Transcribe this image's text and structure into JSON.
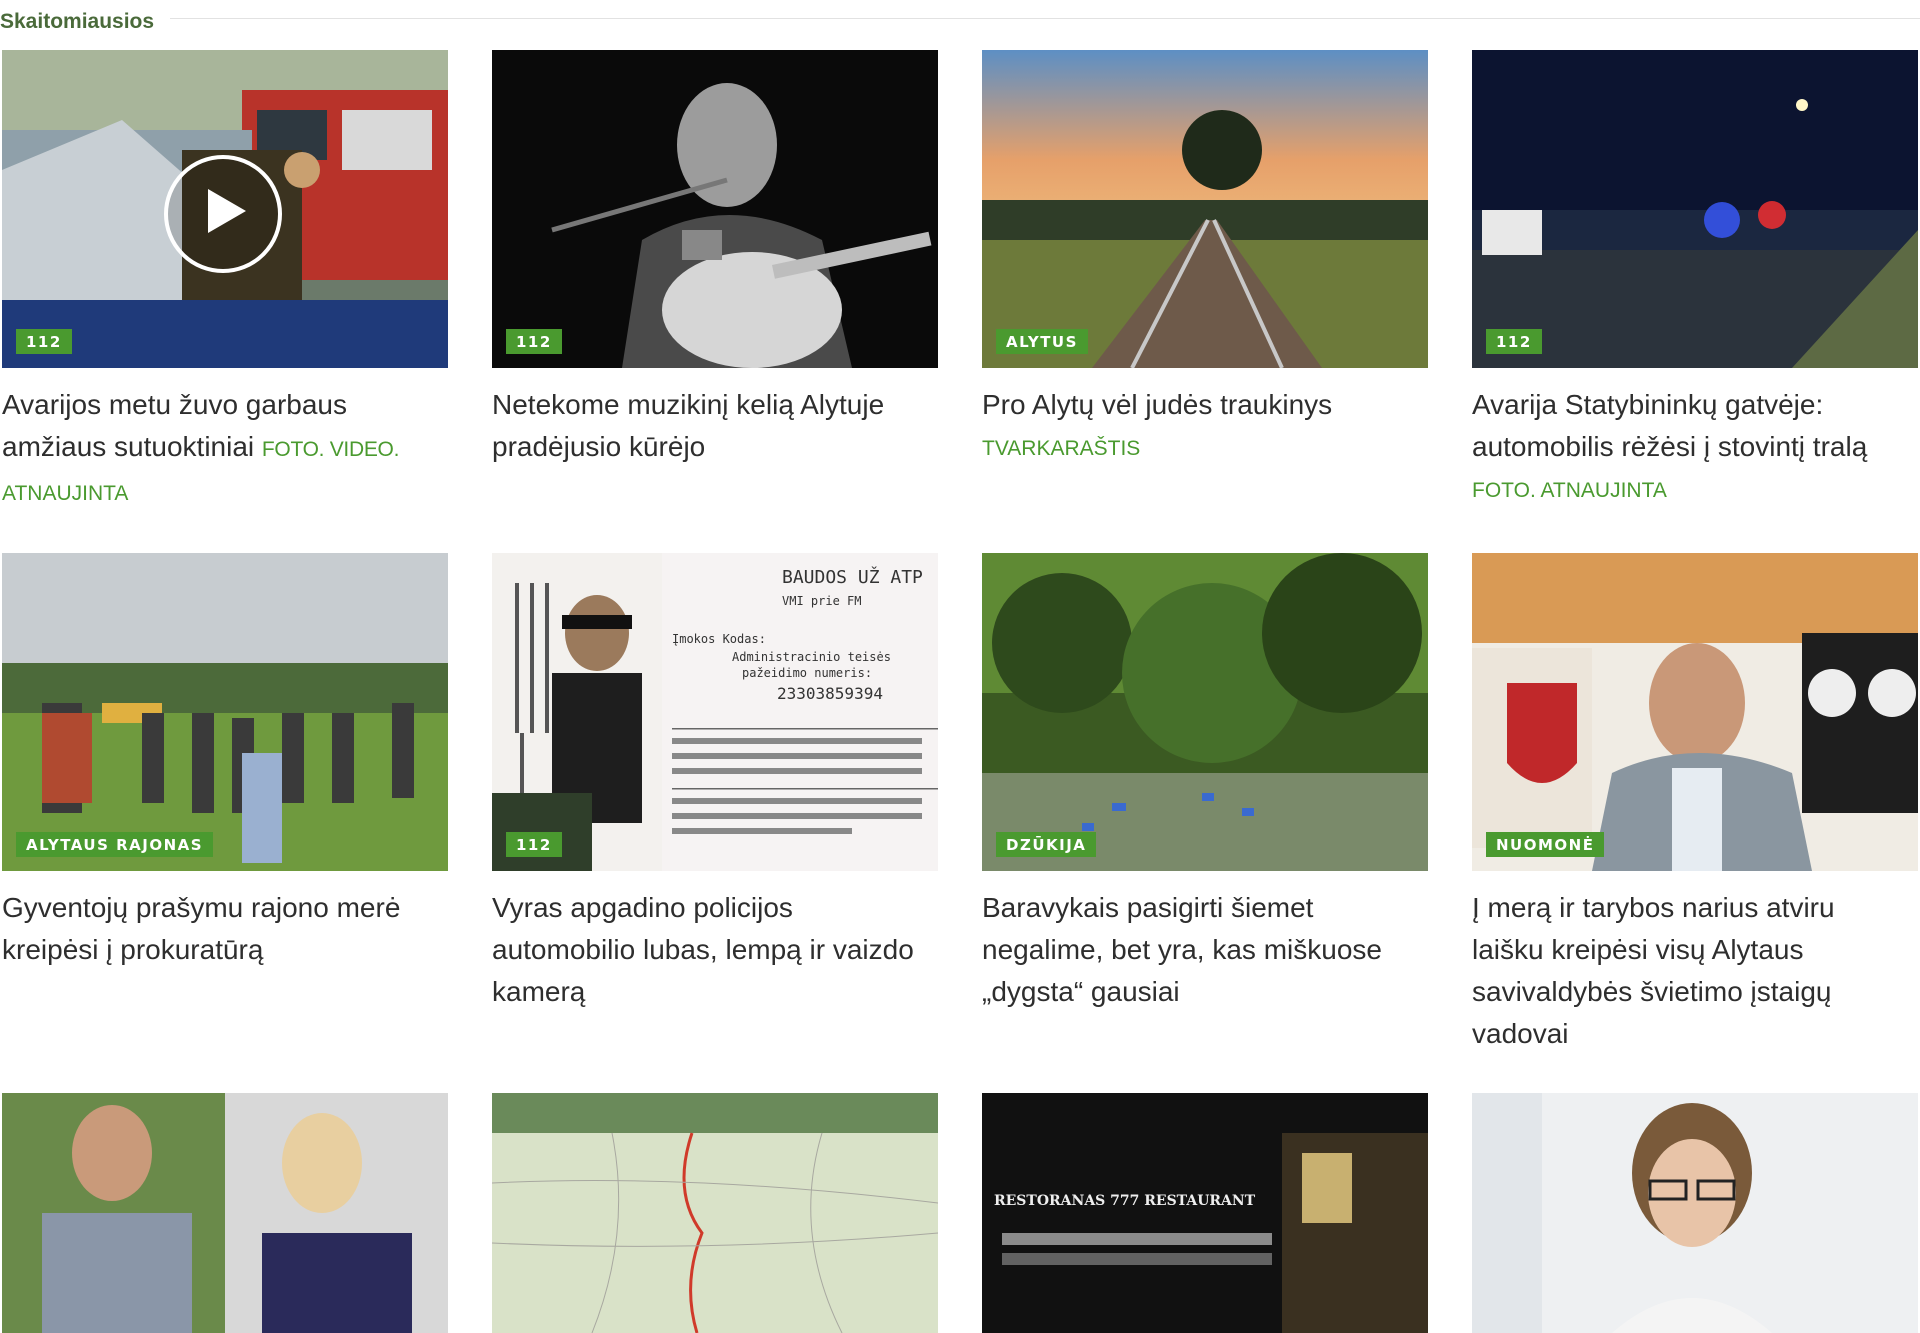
{
  "section": {
    "title": "Skaitomiausios"
  },
  "accent": "#4a9a2f",
  "articles": [
    {
      "badge": "112",
      "title": "Avarijos metu žuvo garbaus amžiaus sutuoktiniai",
      "tag": "FOTO. VIDEO.",
      "tag2": "ATNAUJINTA",
      "has_video": true
    },
    {
      "badge": "112",
      "title": "Netekome muzikinį kelią Alytuje pradėjusio kūrėjo",
      "tag": "",
      "tag2": ""
    },
    {
      "badge": "ALYTUS",
      "title": "Pro Alytų vėl judės traukinys",
      "tag": "",
      "tag2": "TVARKARAŠTIS"
    },
    {
      "badge": "112",
      "title": "Avarija Statybininkų gatvėje: automobilis rėžėsi į stovintį tralą",
      "tag": "",
      "tag2": "FOTO. ATNAUJINTA"
    },
    {
      "badge": "ALYTAUS RAJONAS",
      "title": "Gyventojų prašymu rajono merė kreipėsi į prokuratūrą",
      "tag": "",
      "tag2": ""
    },
    {
      "badge": "112",
      "title": "Vyras apgadino policijos automobilio lubas, lempą ir vaizdo kamerą",
      "tag": "",
      "tag2": ""
    },
    {
      "badge": "DZŪKIJA",
      "title": "Baravykais pasigirti šiemet negalime, bet yra, kas miškuose „dygsta“ gausiai",
      "tag": "",
      "tag2": ""
    },
    {
      "badge": "NUOMONĖ",
      "title": "Į merą ir tarybos narius atviru laišku kreipėsi visų Alytaus savivaldybės švietimo įstaigų vadovai",
      "tag": "",
      "tag2": ""
    }
  ],
  "ticket": {
    "heading": "BAUDOS UŽ ATP",
    "sub": "VMI prie FM",
    "code_label": "Įmokos Kodas:",
    "line1": "Administracinio teisės",
    "line2": "pažeidimo numeris:",
    "number": "23303859394"
  },
  "restaurant": {
    "sign": "RESTORANAS  777  RESTAURANT"
  }
}
